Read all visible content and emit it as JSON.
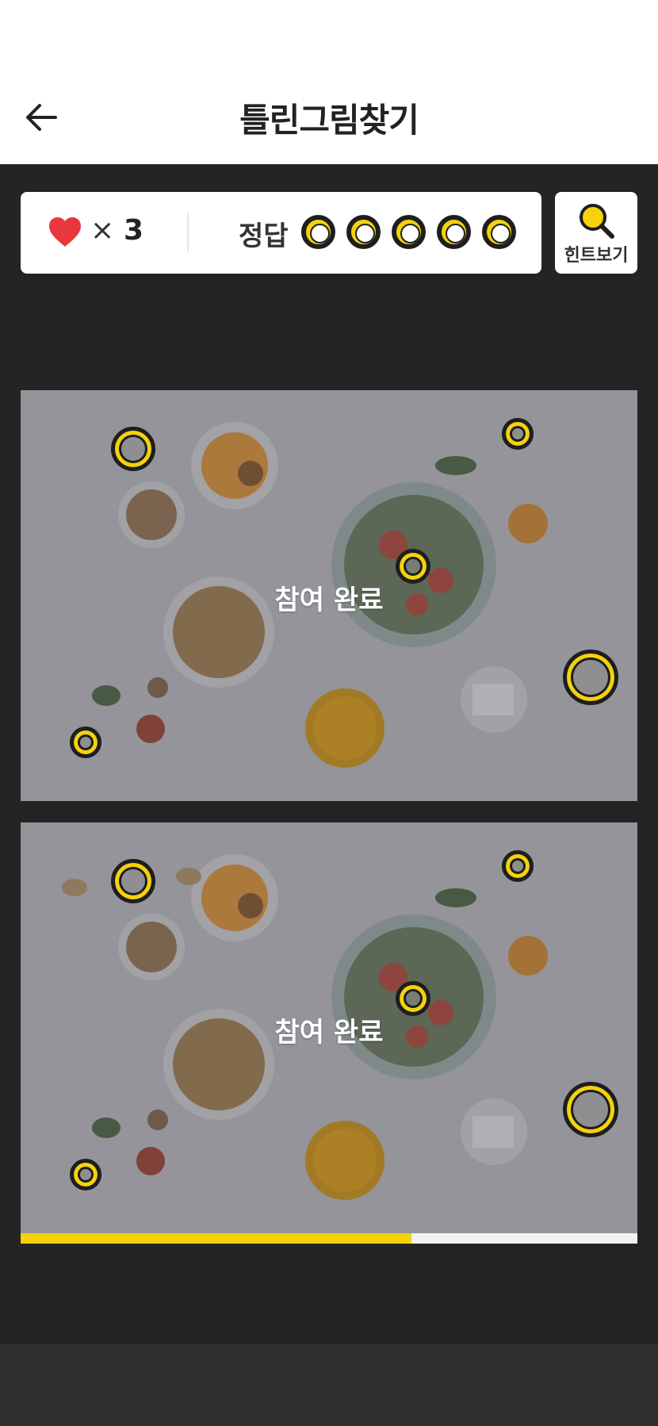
{
  "header": {
    "title": "틀린그림찾기"
  },
  "status": {
    "lives_times": "×",
    "lives_count": "3",
    "answer_label": "정답",
    "answers_total": 5
  },
  "hint": {
    "label": "힌트보기"
  },
  "puzzle": {
    "top_status": "참여 완료",
    "bottom_status": "참여 완료"
  },
  "progress": {
    "fraction": 0.634
  },
  "colors": {
    "accent": "#f5d20b",
    "heart": "#e8383d",
    "background": "#242424"
  }
}
